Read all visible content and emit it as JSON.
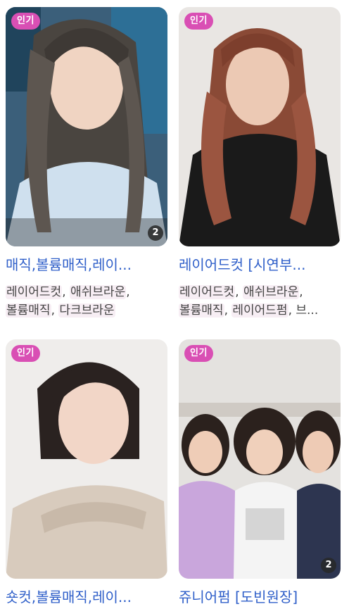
{
  "cards": [
    {
      "badge": "인기",
      "count": "2",
      "title": "매직,볼륨매직,레이...",
      "tags_line1": [
        "레이어드컷",
        "애쉬브라운"
      ],
      "tags_line2": [
        "볼륨매직",
        "다크브라운"
      ]
    },
    {
      "badge": "인기",
      "count": "",
      "title": "레이어드컷 [시연부...",
      "tags_line1": [
        "레이어드컷",
        "애쉬브라운"
      ],
      "tags_line2": [
        "볼륨매직",
        "레이어드펌",
        "브..."
      ]
    },
    {
      "badge": "인기",
      "count": "",
      "title": "숏컷,볼륨매직,레이...",
      "tags_line1": [],
      "tags_line2": []
    },
    {
      "badge": "인기",
      "count": "2",
      "title": "쥬니어펌 [도빈원장]",
      "tags_line1": [],
      "tags_line2": []
    }
  ],
  "colors": {
    "badge": "#d94fb4",
    "title": "#2f5fc9",
    "tag_bg": "#f7eef4"
  }
}
